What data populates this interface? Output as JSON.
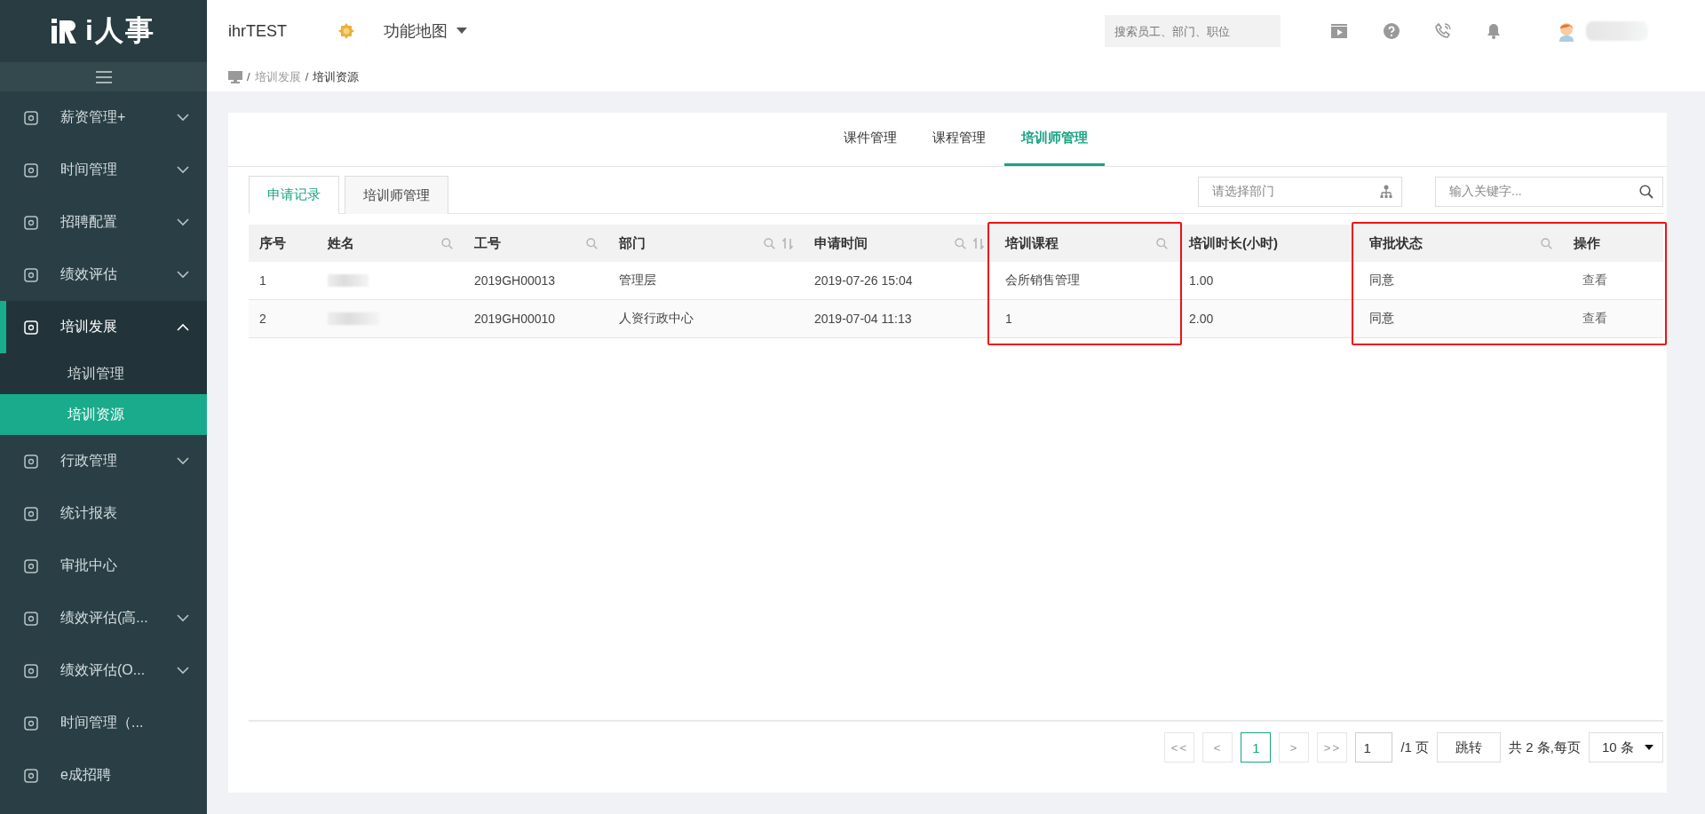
{
  "logo": {
    "text": "i人事"
  },
  "sidebar": {
    "items": [
      {
        "label": "薪资管理+",
        "expanded": false,
        "selected": false
      },
      {
        "label": "时间管理",
        "expanded": false,
        "selected": false
      },
      {
        "label": "招聘配置",
        "expanded": false,
        "selected": false
      },
      {
        "label": "绩效评估",
        "expanded": false,
        "selected": false
      },
      {
        "label": "培训发展",
        "expanded": true,
        "selected": true,
        "children": [
          {
            "label": "培训管理",
            "selected": false
          },
          {
            "label": "培训资源",
            "selected": true
          }
        ]
      },
      {
        "label": "行政管理",
        "expanded": false,
        "selected": false
      },
      {
        "label": "统计报表",
        "selected": false
      },
      {
        "label": "审批中心",
        "selected": false
      },
      {
        "label": "绩效评估(高...",
        "expanded": false,
        "selected": false
      },
      {
        "label": "绩效评估(O...",
        "expanded": false,
        "selected": false
      },
      {
        "label": "时间管理（...",
        "selected": false
      },
      {
        "label": "e成招聘",
        "selected": false
      }
    ]
  },
  "header": {
    "company": "ihrTEST",
    "menu": "功能地图",
    "search": {
      "placeholder": "搜索员工、部门、职位"
    },
    "user": {
      "name_redacted": true
    }
  },
  "breadcrumb": {
    "separator": "/",
    "items": [
      "培训发展",
      "培训资源"
    ]
  },
  "top_tabs": [
    {
      "label": "课件管理",
      "selected": false
    },
    {
      "label": "课程管理",
      "selected": false
    },
    {
      "label": "培训师管理",
      "selected": true
    }
  ],
  "sub_tabs": [
    {
      "label": "申请记录",
      "selected": true
    },
    {
      "label": "培训师管理",
      "selected": false
    }
  ],
  "filters": {
    "department": {
      "placeholder": "请选择部门"
    },
    "keyword": {
      "placeholder": "输入关键字..."
    }
  },
  "table": {
    "columns": [
      {
        "label": "序号",
        "searchable": false,
        "sortable": false,
        "outlined": false
      },
      {
        "label": "姓名",
        "searchable": true,
        "sortable": false,
        "outlined": false
      },
      {
        "label": "工号",
        "searchable": true,
        "sortable": false,
        "outlined": false
      },
      {
        "label": "部门",
        "searchable": true,
        "sortable": true,
        "outlined": false
      },
      {
        "label": "申请时间",
        "searchable": true,
        "sortable": true,
        "outlined": false
      },
      {
        "label": "培训课程",
        "searchable": true,
        "sortable": false,
        "outlined": true
      },
      {
        "label": "培训时长(小时)",
        "searchable": false,
        "sortable": false,
        "outlined": false
      },
      {
        "label": "审批状态",
        "searchable": true,
        "sortable": false,
        "outlined": true
      },
      {
        "label": "操作",
        "searchable": false,
        "sortable": false,
        "outlined": true
      }
    ],
    "rows": [
      {
        "index": "1",
        "name_redacted": true,
        "employee_id": "2019GH00013",
        "department": "管理层",
        "apply_time": "2019-07-26 15:04",
        "course": "会所销售管理",
        "hours": "1.00",
        "status": "同意",
        "action": "查看"
      },
      {
        "index": "2",
        "name_redacted": true,
        "employee_id": "2019GH00010",
        "department": "人资行政中心",
        "apply_time": "2019-07-04 11:13",
        "course": "1",
        "hours": "2.00",
        "status": "同意",
        "action": "查看"
      }
    ]
  },
  "pagination": {
    "first": "<<",
    "prev": "<",
    "pages": [
      {
        "label": "1",
        "selected": true
      }
    ],
    "next": ">",
    "last": ">>",
    "page_input": "1",
    "total_pages": "/1 页",
    "jump": "跳转",
    "summary": "共 2 条,每页",
    "page_size": "10 条"
  }
}
